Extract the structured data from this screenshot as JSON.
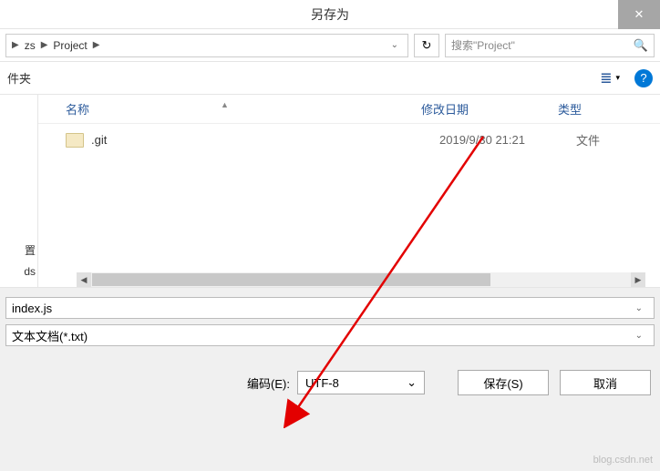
{
  "title": "另存为",
  "close_glyph": "✕",
  "breadcrumb": {
    "item0": "zs",
    "item1": "Project",
    "sep": "▶"
  },
  "refresh_glyph": "↻",
  "search": {
    "placeholder": "搜索\"Project\"",
    "icon": "🔍"
  },
  "toolbar": {
    "left_label": "件夹",
    "view_icon": "≣",
    "view_chev": "▾",
    "help_glyph": "?"
  },
  "sidebar": {
    "item0": "置",
    "item1": "ds"
  },
  "columns": {
    "name": "名称",
    "date": "修改日期",
    "type": "类型",
    "sort_arrow": "▲"
  },
  "rows": [
    {
      "name": ".git",
      "date": "2019/9/30 21:21",
      "type": "文件"
    }
  ],
  "scroll": {
    "left": "◀",
    "right": "▶"
  },
  "filename": {
    "value": "index.js"
  },
  "filetype": {
    "value": "文本文档(*.txt)"
  },
  "encoding": {
    "label": "编码(E):",
    "value": "UTF-8",
    "chev": "⌄"
  },
  "buttons": {
    "save": "保存(S)",
    "cancel": "取消"
  },
  "watermark": "blog.csdn.net"
}
